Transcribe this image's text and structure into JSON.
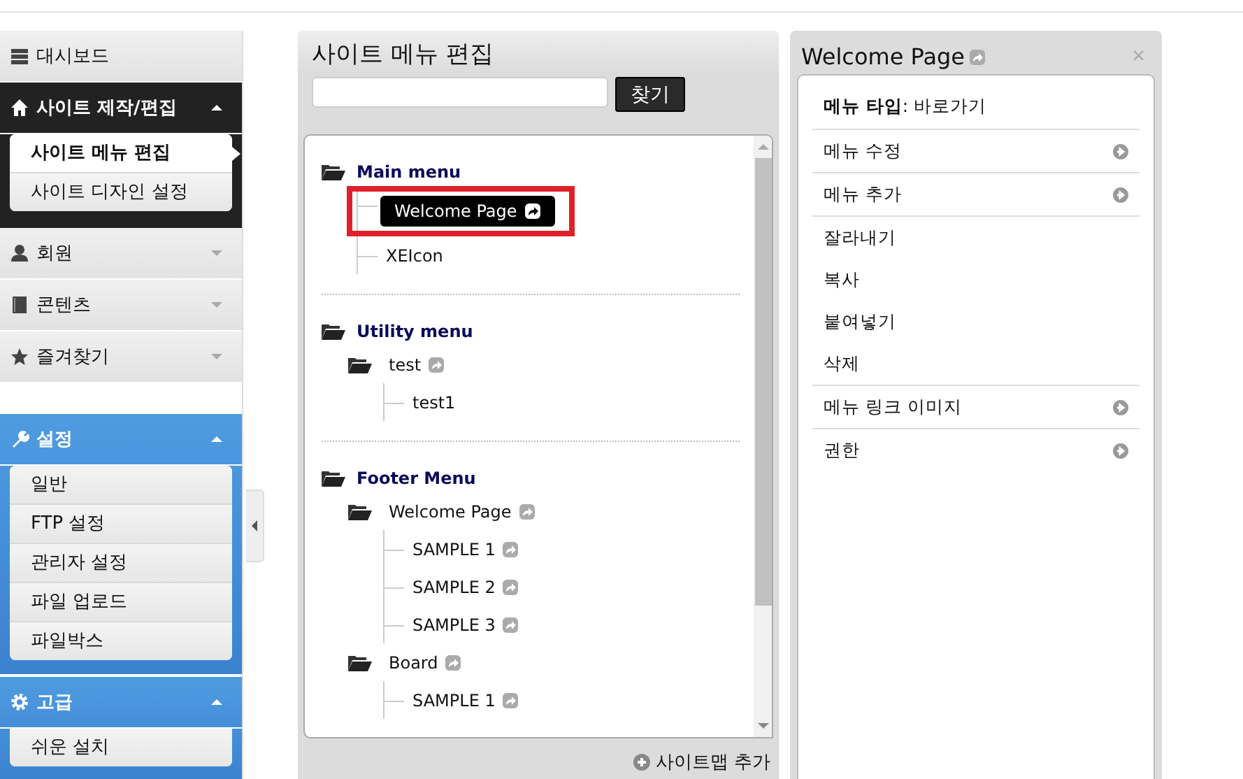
{
  "sidebar": {
    "sections": [
      {
        "label": "대시보드",
        "kind": "plain"
      },
      {
        "label": "사이트 제작/편집",
        "kind": "dark",
        "expanded": true,
        "items": [
          {
            "label": "사이트 메뉴 편집",
            "selected": true
          },
          {
            "label": "사이트 디자인 설정",
            "selected": false
          }
        ]
      },
      {
        "label": "회원",
        "kind": "plain",
        "expanded": false
      },
      {
        "label": "콘텐츠",
        "kind": "plain",
        "expanded": false
      },
      {
        "label": "즐겨찾기",
        "kind": "plain",
        "expanded": false
      },
      {
        "label": "설정",
        "kind": "blue",
        "expanded": true,
        "items": [
          {
            "label": "일반",
            "selected": false
          },
          {
            "label": "FTP 설정",
            "selected": false
          },
          {
            "label": "관리자 설정",
            "selected": false
          },
          {
            "label": "파일 업로드",
            "selected": false
          },
          {
            "label": "파일박스",
            "selected": false
          }
        ]
      },
      {
        "label": "고급",
        "kind": "blue",
        "expanded": true,
        "items": [
          {
            "label": "쉬운 설치",
            "selected": false
          }
        ]
      }
    ]
  },
  "editor": {
    "title": "사이트 메뉴 편집",
    "search_button": "찾기",
    "groups": [
      {
        "label": "Main menu",
        "children": [
          {
            "label": "Welcome Page",
            "link": true,
            "selected": true,
            "highlighted": true
          },
          {
            "label": "XEIcon",
            "link": false,
            "selected": false
          }
        ]
      },
      {
        "label": "Utility menu",
        "children": [
          {
            "label": "test",
            "link": true,
            "selected": false,
            "children": [
              {
                "label": "test1",
                "link": false,
                "selected": false
              }
            ]
          }
        ]
      },
      {
        "label": "Footer Menu",
        "children": [
          {
            "label": "Welcome Page",
            "link": true,
            "selected": false,
            "children": [
              {
                "label": "SAMPLE 1",
                "link": true,
                "selected": false
              },
              {
                "label": "SAMPLE 2",
                "link": true,
                "selected": false
              },
              {
                "label": "SAMPLE 3",
                "link": true,
                "selected": false
              }
            ]
          },
          {
            "label": "Board",
            "link": true,
            "selected": false,
            "children": [
              {
                "label": "SAMPLE 1",
                "link": true,
                "selected": false
              }
            ]
          }
        ]
      }
    ],
    "add_button": "사이트맵 추가"
  },
  "details": {
    "title": "Welcome Page",
    "close": "×",
    "menu_type": "**메뉴 타입**: 바로가기",
    "action_groups": [
      [
        {
          "label": "메뉴 수정",
          "submenu": true
        }
      ],
      [
        {
          "label": "메뉴 추가",
          "submenu": true
        }
      ],
      [
        {
          "label": "잘라내기",
          "submenu": false
        },
        {
          "label": "복사",
          "submenu": false
        },
        {
          "label": "붙여넣기",
          "submenu": false
        },
        {
          "label": "삭제",
          "submenu": false
        }
      ],
      [
        {
          "label": "메뉴 링크 이미지",
          "submenu": true
        }
      ],
      [
        {
          "label": "권한",
          "submenu": true
        }
      ]
    ]
  }
}
